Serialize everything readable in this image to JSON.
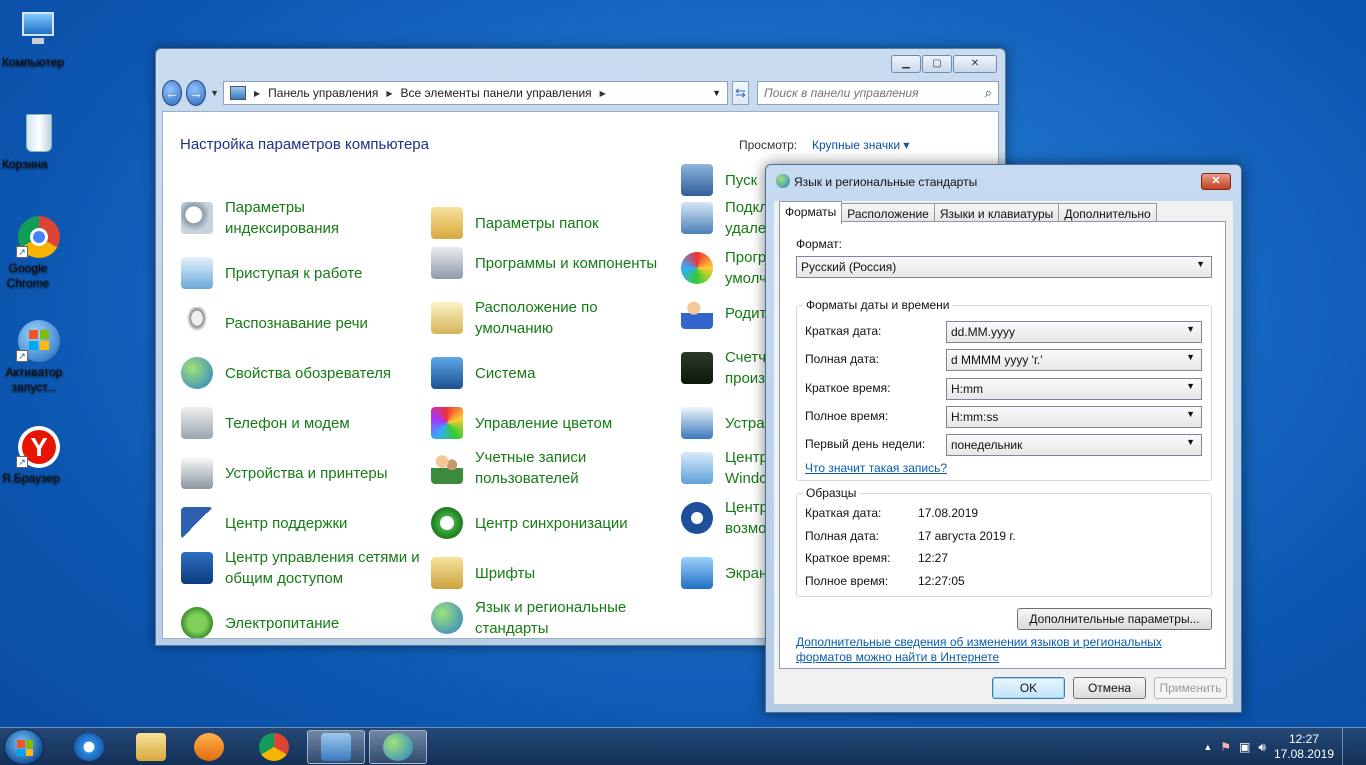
{
  "desktop": {
    "icons": [
      {
        "label": "Компьютер"
      },
      {
        "label": "Корзина"
      },
      {
        "label": "Google Chrome"
      },
      {
        "label": "Активатор запуст..."
      },
      {
        "label": "Я.Браузер"
      }
    ]
  },
  "control_panel": {
    "breadcrumb": [
      "Панель управления",
      "Все элементы панели управления"
    ],
    "search_placeholder": "Поиск в панели управления",
    "title": "Настройка параметров компьютера",
    "view_label": "Просмотр:",
    "view_value": "Крупные значки",
    "col1": [
      "Параметры индексирования",
      "Приступая к работе",
      "Распознавание речи",
      "Свойства обозревателя",
      "Телефон и модем",
      "Устройства и принтеры",
      "Центр поддержки",
      "Центр управления сетями и общим доступом",
      "Электропитание"
    ],
    "col2": [
      "Параметры папок",
      "Программы и компоненты",
      "Расположение по умолчанию",
      "Система",
      "Управление цветом",
      "Учетные записи пользователей",
      "Центр синхронизации",
      "Шрифты",
      "Язык и региональные стандарты"
    ],
    "col3": [
      "Пуск",
      "Подкл удале",
      "Прогр умолч",
      "Родит",
      "Счетч произ",
      "Устра",
      "Центр Windo",
      "Центр возмо",
      "Экран"
    ]
  },
  "dialog": {
    "title": "Язык и региональные стандарты",
    "close_label": "✕",
    "tabs": [
      "Форматы",
      "Расположение",
      "Языки и клавиатуры",
      "Дополнительно"
    ],
    "format_label": "Формат:",
    "format_value": "Русский (Россия)",
    "datetime_group": "Форматы даты и времени",
    "short_date_label": "Краткая дата:",
    "short_date_value": "dd.MM.yyyy",
    "long_date_label": "Полная дата:",
    "long_date_value": "d MMMM yyyy 'г.'",
    "short_time_label": "Краткое время:",
    "short_time_value": "H:mm",
    "long_time_label": "Полное время:",
    "long_time_value": "H:mm:ss",
    "first_day_label": "Первый день недели:",
    "first_day_value": "понедельник",
    "notation_link": "Что значит такая запись?",
    "samples_group": "Образцы",
    "sample_short_date_label": "Краткая дата:",
    "sample_short_date": "17.08.2019",
    "sample_long_date_label": "Полная дата:",
    "sample_long_date": "17 августа 2019 г.",
    "sample_short_time_label": "Краткое время:",
    "sample_short_time": "12:27",
    "sample_long_time_label": "Полное время:",
    "sample_long_time": "12:27:05",
    "advanced_button": "Дополнительные параметры...",
    "info_link": "Дополнительные сведения об изменении языков и региональных форматов можно найти в Интернете",
    "ok": "OK",
    "cancel": "Отмена",
    "apply": "Применить"
  },
  "taskbar": {
    "time": "12:27",
    "date": "17.08.2019"
  }
}
